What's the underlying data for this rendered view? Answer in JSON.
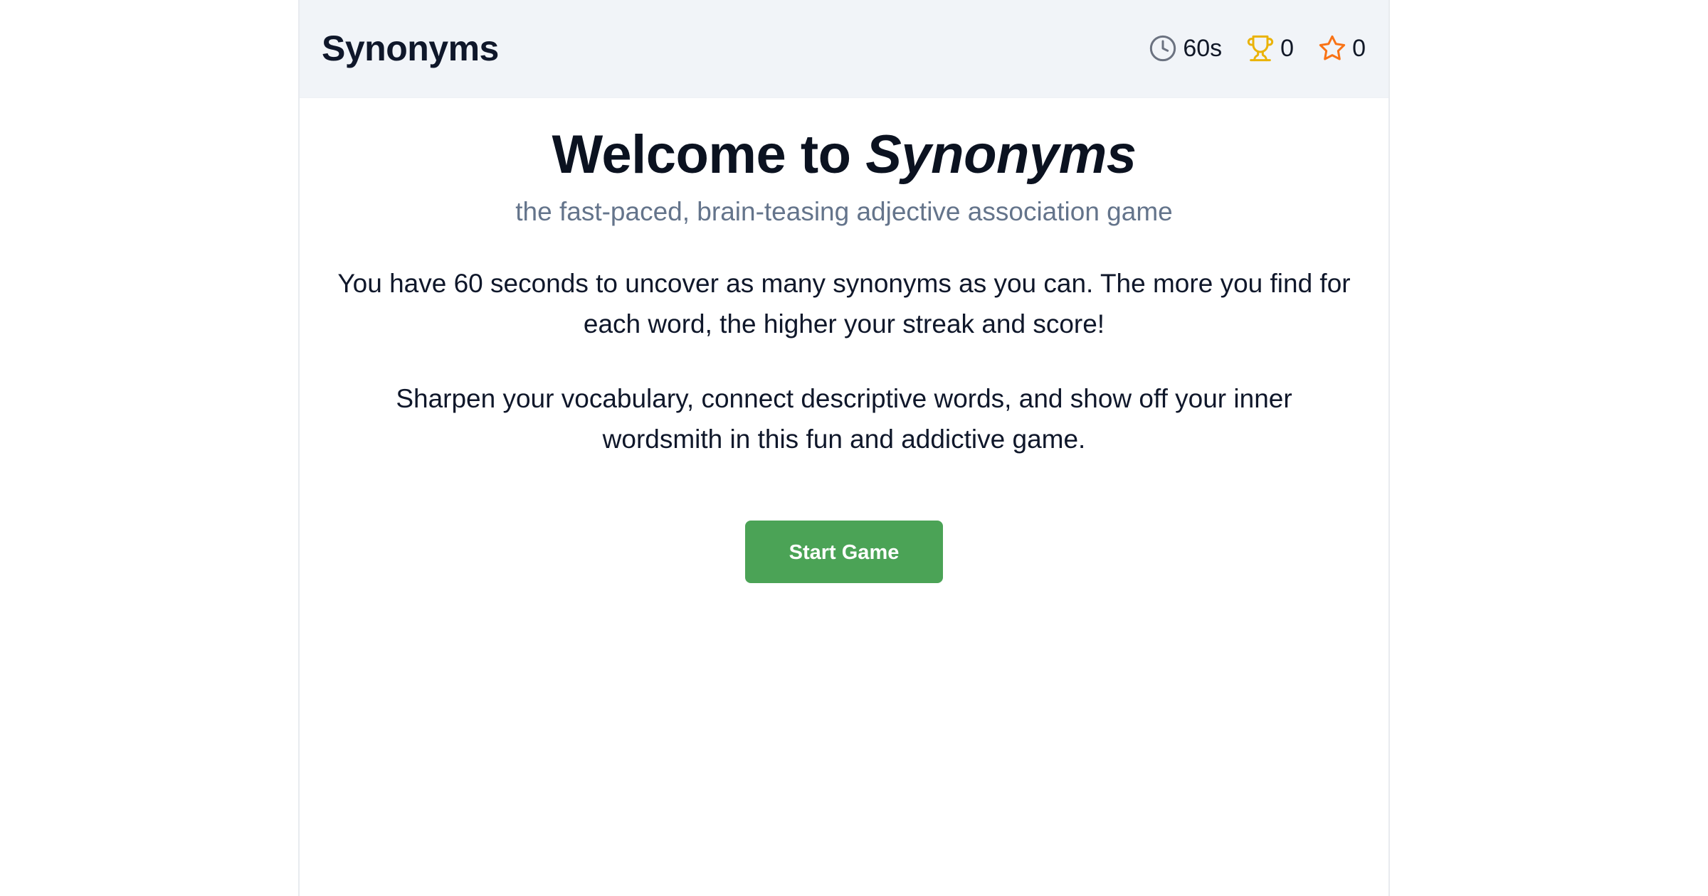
{
  "header": {
    "app_title": "Synonyms",
    "stats": {
      "timer": {
        "icon": "clock-icon",
        "value": "60s",
        "color": "#6b7280"
      },
      "trophy": {
        "icon": "trophy-icon",
        "value": "0",
        "color": "#eab308"
      },
      "star": {
        "icon": "star-icon",
        "value": "0",
        "color": "#f97316"
      }
    }
  },
  "main": {
    "welcome_prefix": "Welcome to ",
    "welcome_name": "Synonyms",
    "subtitle": "the fast-paced, brain-teasing adjective association game",
    "paragraph1": "You have 60 seconds to uncover as many synonyms as you can. The more you find for each word, the higher your streak and score!",
    "paragraph2": "Sharpen your vocabulary, connect descriptive words, and show off your inner wordsmith in this fun and addictive game.",
    "start_button_label": "Start Game"
  },
  "colors": {
    "accent_green": "#4ba356",
    "header_bg": "#f1f4f8",
    "subtitle_gray": "#64748b"
  }
}
